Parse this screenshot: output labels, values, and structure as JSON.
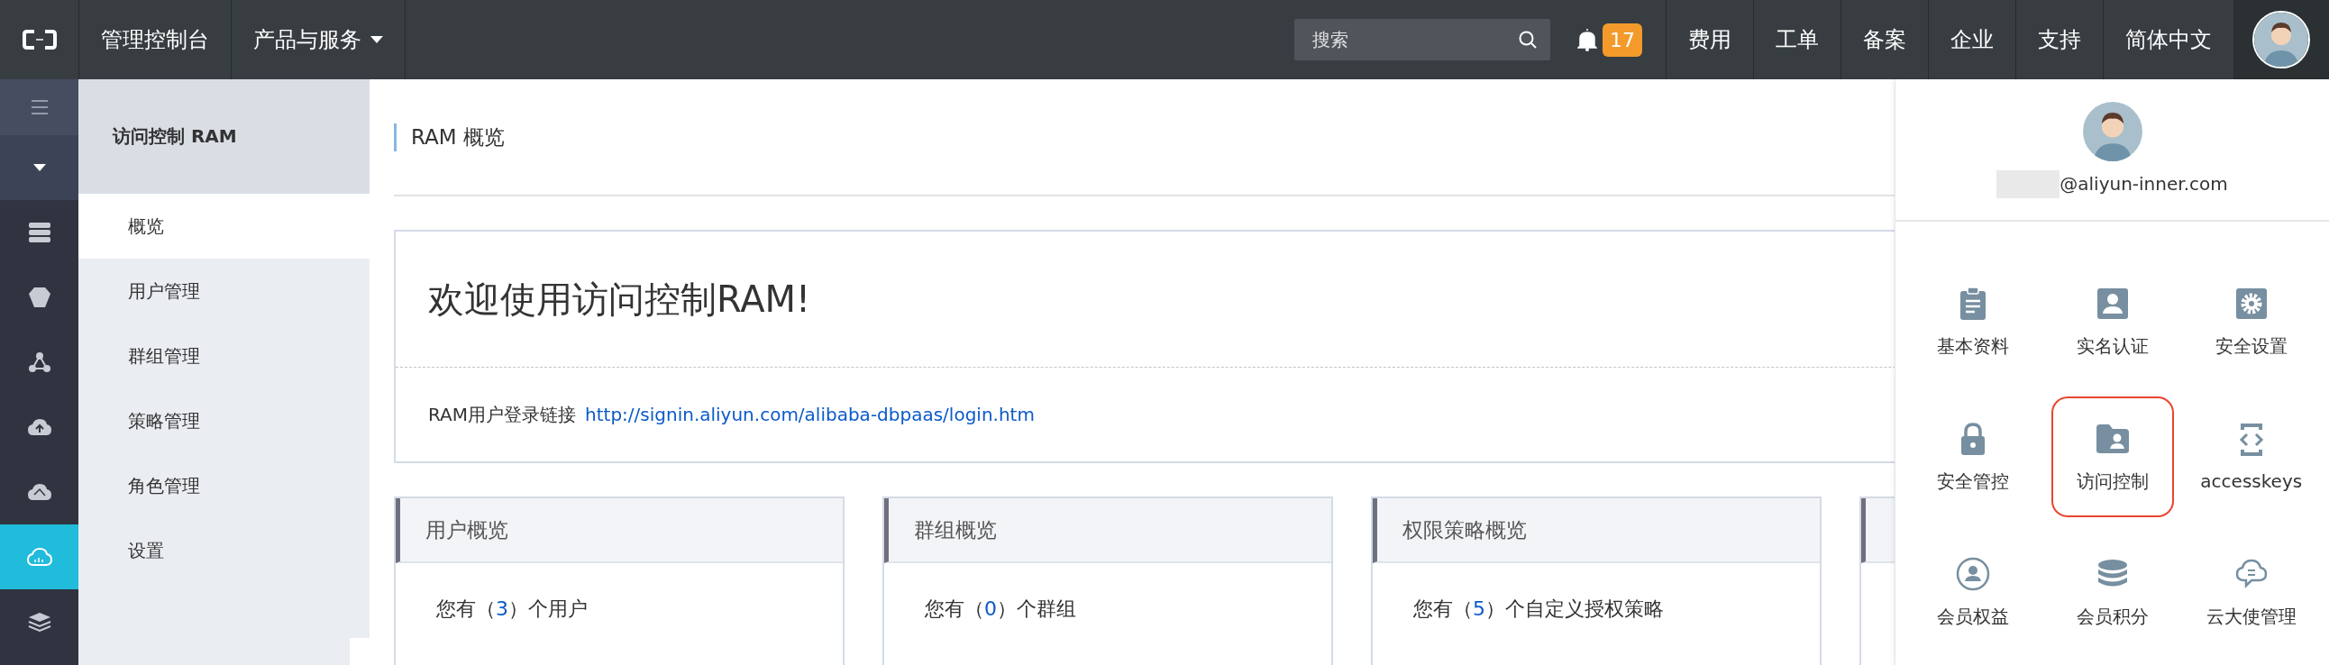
{
  "top_bar": {
    "console": "管理控制台",
    "products": "产品与服务",
    "search": {
      "placeholder": "搜索"
    },
    "notification_count": "17",
    "links": [
      "费用",
      "工单",
      "备案",
      "企业",
      "支持",
      "简体中文"
    ]
  },
  "rail": {
    "items": [
      {
        "kind": "menu",
        "selected": false
      },
      {
        "kind": "caret",
        "selected": false
      },
      {
        "kind": "server",
        "selected": false
      },
      {
        "kind": "hexagon",
        "selected": false
      },
      {
        "kind": "nodes",
        "selected": false
      },
      {
        "kind": "cloud-upload",
        "selected": false
      },
      {
        "kind": "cloud-nodes",
        "selected": false
      },
      {
        "kind": "cloud",
        "selected": true
      },
      {
        "kind": "layers",
        "selected": false
      }
    ]
  },
  "submenu": {
    "title": "访问控制 RAM",
    "items": [
      {
        "label": "概览",
        "selected": true
      },
      {
        "label": "用户管理",
        "selected": false
      },
      {
        "label": "群组管理",
        "selected": false
      },
      {
        "label": "策略管理",
        "selected": false
      },
      {
        "label": "角色管理",
        "selected": false
      },
      {
        "label": "设置",
        "selected": false
      }
    ]
  },
  "page_title": "RAM 概览",
  "welcome": {
    "title": "欢迎使用访问控制RAM!",
    "link_label": "RAM用户登录链接",
    "link": "http://signin.aliyun.com/alibaba-dbpaas/login.htm"
  },
  "cards": [
    {
      "title": "用户概览",
      "prefix": "您有（",
      "count": "3",
      "suffix": "）个用户"
    },
    {
      "title": "群组概览",
      "prefix": "您有（",
      "count": "0",
      "suffix": "）个群组"
    },
    {
      "title": "权限策略概览",
      "prefix": "您有（",
      "count": "5",
      "suffix": "）个自定义授权策略"
    }
  ],
  "user_menu": {
    "email": "@aliyun-inner.com",
    "items": [
      {
        "label": "基本资料",
        "kind": "clipboard",
        "highlighted": false
      },
      {
        "label": "实名认证",
        "kind": "person-card",
        "highlighted": false
      },
      {
        "label": "安全设置",
        "kind": "gear",
        "highlighted": false
      },
      {
        "label": "安全管控",
        "kind": "lock",
        "highlighted": false
      },
      {
        "label": "访问控制",
        "kind": "folder-person",
        "highlighted": true
      },
      {
        "label": "accesskeys",
        "kind": "code-phone",
        "highlighted": false
      },
      {
        "label": "会员权益",
        "kind": "person-circle",
        "highlighted": false
      },
      {
        "label": "会员积分",
        "kind": "coins",
        "highlighted": false
      },
      {
        "label": "云大使管理",
        "kind": "cloud-chat",
        "highlighted": false
      }
    ]
  }
}
